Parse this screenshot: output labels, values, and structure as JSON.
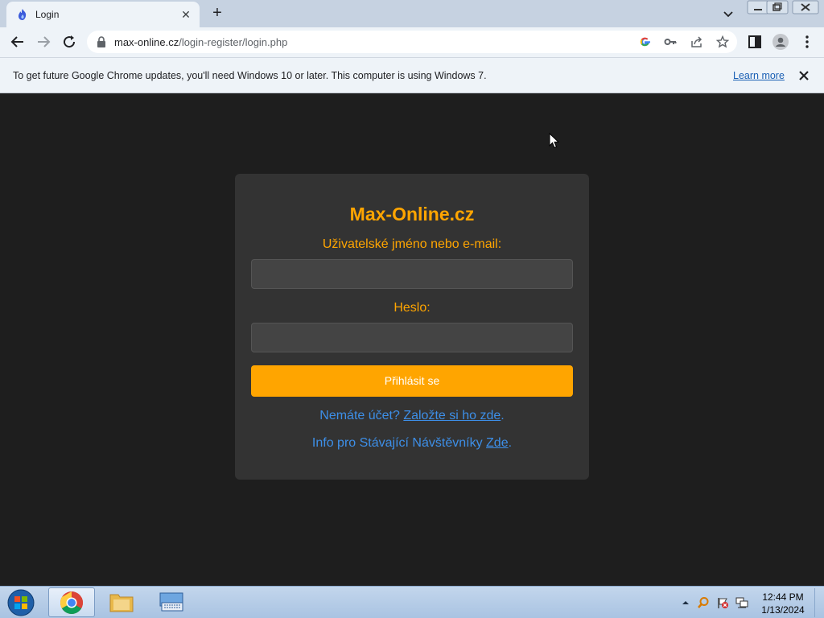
{
  "browser": {
    "tab": {
      "title": "Login",
      "favicon": "flame-icon"
    },
    "url_domain": "max-online.cz",
    "url_path": "/login-register/login.php"
  },
  "infobar": {
    "message": "To get future Google Chrome updates, you'll need Windows 10 or later. This computer is using Windows 7.",
    "learn_more": "Learn more"
  },
  "login": {
    "title": "Max-Online.cz",
    "username_label": "Uživatelské jméno nebo e-mail:",
    "username_value": "",
    "password_label": "Heslo:",
    "password_value": "",
    "submit_label": "Přihlásit se",
    "no_account_text": "Nemáte účet?",
    "register_link": "Založte si ho zde",
    "register_suffix": ".",
    "info_text": "Info pro Stávající Návštěvníky",
    "info_link": "Zde",
    "info_suffix": "."
  },
  "taskbar": {
    "time": "12:44 PM",
    "date": "1/13/2024"
  },
  "colors": {
    "accent": "#ffa500",
    "link": "#3d8fe8",
    "page_bg": "#1e1e1e",
    "card_bg": "#333333"
  }
}
